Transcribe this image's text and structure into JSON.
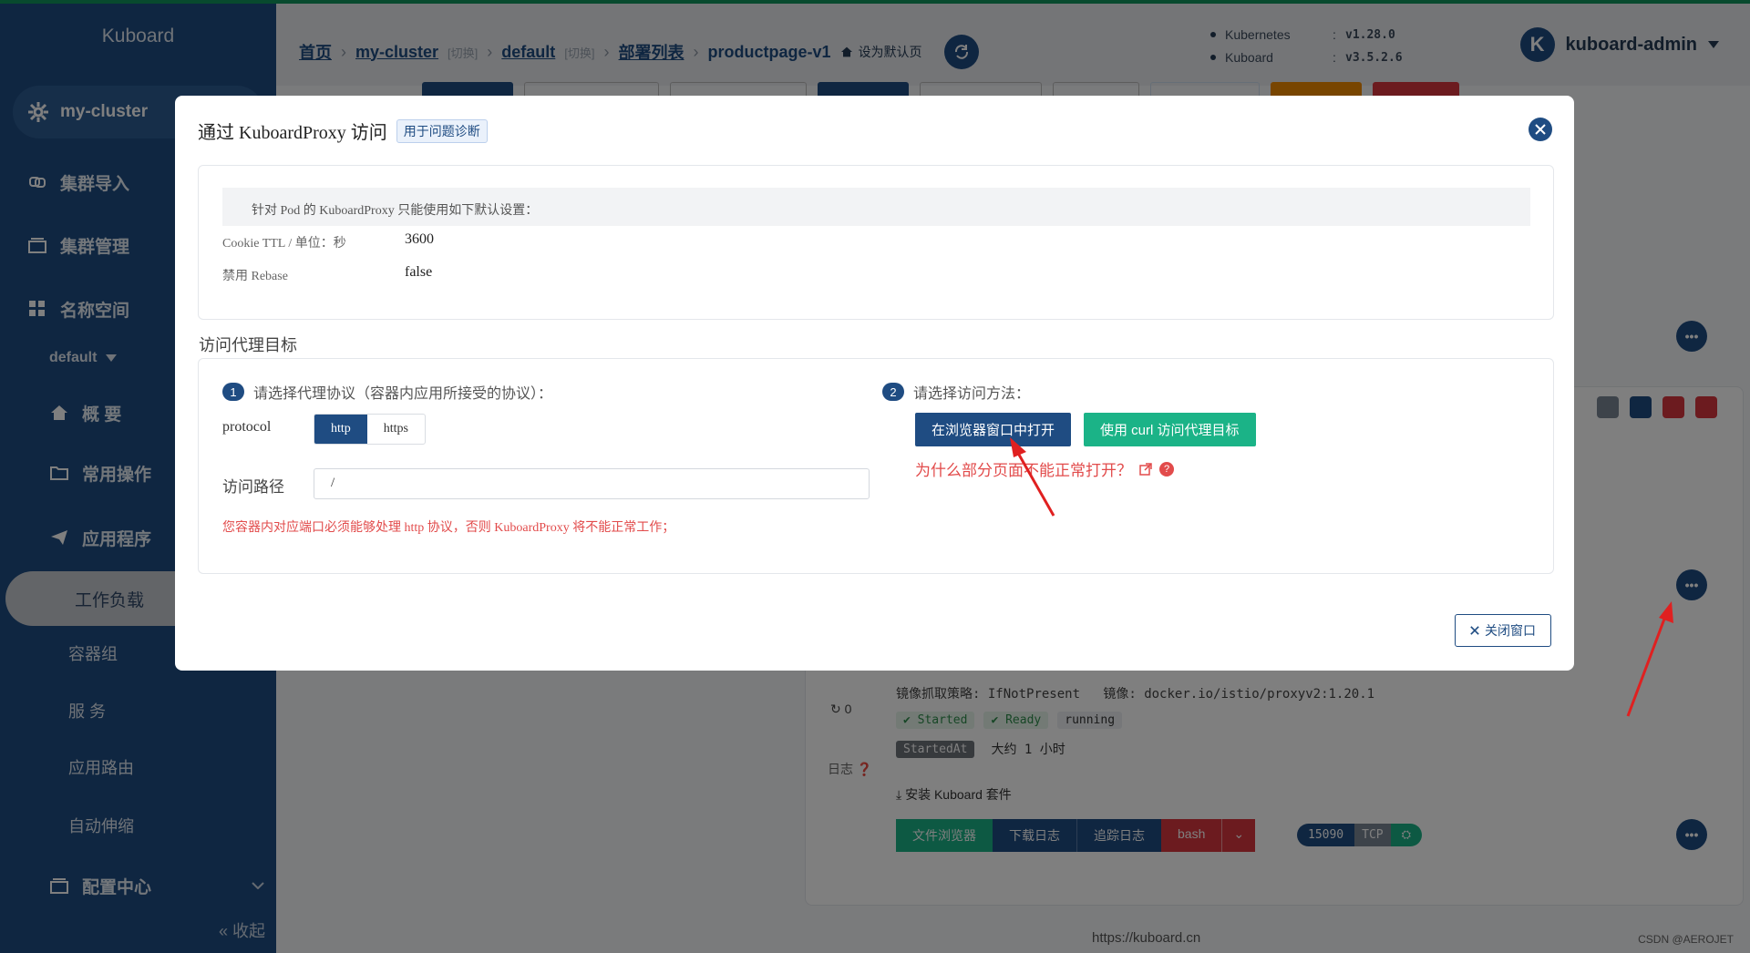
{
  "sidebar": {
    "brand": "Kuboard",
    "cluster": "my-cluster",
    "items": [
      {
        "label": "集群导入"
      },
      {
        "label": "集群管理"
      },
      {
        "label": "名称空间"
      }
    ],
    "namespace": "default",
    "ns_items": [
      {
        "label": "概 要"
      },
      {
        "label": "常用操作"
      },
      {
        "label": "应用程序"
      }
    ],
    "app_items": [
      {
        "label": "工作负载"
      },
      {
        "label": "容器组"
      },
      {
        "label": "服 务"
      },
      {
        "label": "应用路由"
      },
      {
        "label": "自动伸缩"
      }
    ],
    "config_center": "配置中心",
    "collapse": "« 收起"
  },
  "header": {
    "crumbs": {
      "home": "首页",
      "cluster": "my-cluster",
      "cluster_switch": "[切换]",
      "namespace": "default",
      "namespace_switch": "[切换]",
      "deploy_list": "部署列表",
      "current": "productpage-v1",
      "set_default": "设为默认页"
    },
    "versions": [
      {
        "name": "Kubernetes",
        "sep": ":",
        "value": "v1.28.0"
      },
      {
        "name": "Kuboard",
        "sep": ":",
        "value": "v3.5.2.6"
      }
    ],
    "user": {
      "initial": "K",
      "name": "kuboard-admin"
    }
  },
  "background": {
    "container_status": {
      "pull_policy_label": "镜像抓取策略:",
      "pull_policy": "IfNotPresent",
      "image_label": "镜像:",
      "image": "docker.io/istio/proxyv2:1.20.1",
      "restart_count": "0",
      "started": "Started",
      "ready": "Ready",
      "running": "running",
      "started_at_label": "StartedAt",
      "started_at": "大约 1 小时",
      "log_label": "日志",
      "install_suite": "安装 Kuboard 套件",
      "actions": [
        "文件浏览器",
        "下载日志",
        "追踪日志",
        "bash"
      ],
      "port": "15090",
      "protocol": "TCP",
      "partial_value": ".0"
    },
    "footer_link": "https://kuboard.cn",
    "watermark": "CSDN @AEROJET"
  },
  "modal": {
    "title": "通过 KuboardProxy 访问",
    "title_tag": "用于问题诊断",
    "banner": "针对 Pod 的 KuboardProxy 只能使用如下默认设置：",
    "settings": [
      {
        "key": "Cookie TTL / 单位：秒",
        "value": "3600"
      },
      {
        "key": "禁用 Rebase",
        "value": "false"
      }
    ],
    "section_title": "访问代理目标",
    "step1": {
      "num": "1",
      "text": "请选择代理协议（容器内应用所接受的协议）："
    },
    "protocol_label": "protocol",
    "protocols": [
      "http",
      "https"
    ],
    "path_label": "访问路径",
    "path_value": "/",
    "warning": "您容器内对应端口必须能够处理 http 协议，否则 KuboardProxy 将不能正常工作；",
    "step2": {
      "num": "2",
      "text": "请选择访问方法："
    },
    "open_browser": "在浏览器窗口中打开",
    "use_curl": "使用 curl 访问代理目标",
    "help_text": "为什么部分页面不能正常打开？",
    "close_button": "关闭窗口"
  },
  "colors": {
    "primary": "#1f4c82",
    "green": "#1bb387",
    "danger": "#e24b4b",
    "top_stripe": "#11945c"
  }
}
